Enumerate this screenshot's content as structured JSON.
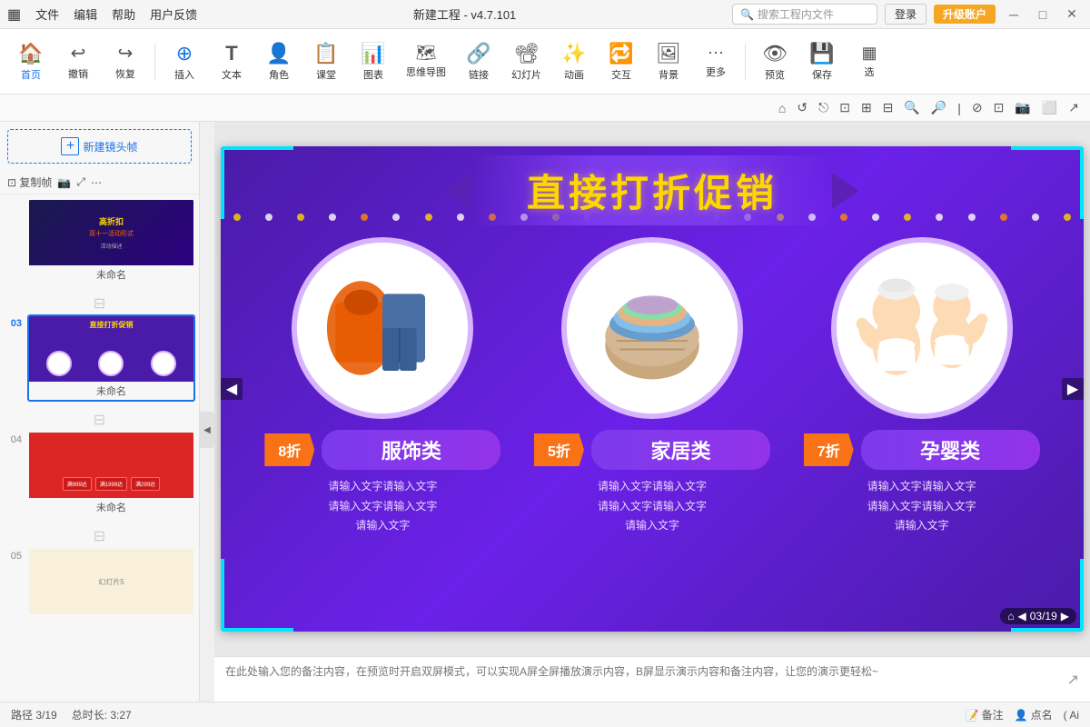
{
  "titleBar": {
    "appIcon": "▦",
    "menus": [
      "文件",
      "编辑",
      "帮助",
      "用户反馈"
    ],
    "title": "新建工程 - v4.7.101",
    "searchPlaceholder": "搜索工程内文件",
    "loginLabel": "登录",
    "upgradeLabel": "升级账户",
    "winMin": "─",
    "winMax": "□",
    "winClose": "✕"
  },
  "toolbar": {
    "items": [
      {
        "id": "home",
        "icon": "🏠",
        "label": "首页"
      },
      {
        "id": "undo",
        "icon": "↩",
        "label": "撤销"
      },
      {
        "id": "redo",
        "icon": "↪",
        "label": "恢复"
      },
      {
        "id": "insert",
        "icon": "⊕",
        "label": "插入"
      },
      {
        "id": "text",
        "icon": "T",
        "label": "文本"
      },
      {
        "id": "role",
        "icon": "👤",
        "label": "角色"
      },
      {
        "id": "classroom",
        "icon": "📋",
        "label": "课堂"
      },
      {
        "id": "chart",
        "icon": "📊",
        "label": "图表"
      },
      {
        "id": "mindmap",
        "icon": "🗺",
        "label": "思维导图"
      },
      {
        "id": "link",
        "icon": "🔗",
        "label": "链接"
      },
      {
        "id": "ppt",
        "icon": "📽",
        "label": "幻灯片"
      },
      {
        "id": "animate",
        "icon": "✨",
        "label": "动画"
      },
      {
        "id": "interact",
        "icon": "🔁",
        "label": "交互"
      },
      {
        "id": "bg",
        "icon": "🖼",
        "label": "背景"
      },
      {
        "id": "more",
        "icon": "⋯",
        "label": "更多"
      },
      {
        "id": "preview",
        "icon": "👁",
        "label": "预览"
      },
      {
        "id": "save",
        "icon": "💾",
        "label": "保存"
      },
      {
        "id": "select",
        "icon": "▦",
        "label": "选"
      }
    ]
  },
  "iconToolbar": {
    "icons": [
      "⌂",
      "↺",
      "⎋",
      "⊡",
      "⊞",
      "⊟",
      "🔍+",
      "🔍-",
      "⋮",
      "⊘",
      "⊡",
      "📷",
      "⬜",
      "↗"
    ]
  },
  "sidebar": {
    "newFrameLabel": "新建镜头帧",
    "copyFrameLabel": "复制帧",
    "cameraIcon": "📷",
    "fitIcon": "⤢",
    "moreIcon": "⋯",
    "slides": [
      {
        "num": "",
        "label": "未命名",
        "active": false,
        "bg": "#1a1a4e"
      },
      {
        "num": "03",
        "label": "未命名",
        "active": true,
        "bg": "#4a1ba8"
      },
      {
        "num": "",
        "label": "",
        "isSep": true
      },
      {
        "num": "04",
        "label": "未命名",
        "active": false,
        "bg": "#dc2626"
      },
      {
        "num": "",
        "label": "",
        "isSep": true
      },
      {
        "num": "05",
        "label": "",
        "active": false,
        "bg": "#fef3c7"
      }
    ]
  },
  "canvas": {
    "title": "直接打折促销",
    "products": [
      {
        "discount": "8折",
        "category": "服饰类",
        "desc1": "请输入文字请输入文字",
        "desc2": "请输入文字请输入文字",
        "desc3": "请输入文字"
      },
      {
        "discount": "5折",
        "category": "家居类",
        "desc1": "请输入文字请输入文字",
        "desc2": "请输入文字请输入文字",
        "desc3": "请输入文字"
      },
      {
        "discount": "7折",
        "category": "孕婴类",
        "desc1": "请输入文字请输入文字",
        "desc2": "请输入文字请输入文字",
        "desc3": "请输入文字"
      }
    ],
    "slideNum": "03",
    "totalSlides": "19",
    "slideCounter": "03/19"
  },
  "notes": {
    "placeholder": "在此处输入您的备注内容，在预览时开启双屏模式，可以实现A屏全屏播放演示内容，B屏显示演示内容和备注内容，让您的演示更轻松~"
  },
  "statusBar": {
    "path": "路径 3/19",
    "duration": "总时长: 3:27",
    "notesLabel": "备注",
    "callLabel": "点名",
    "aiLabel": "( Ai"
  }
}
